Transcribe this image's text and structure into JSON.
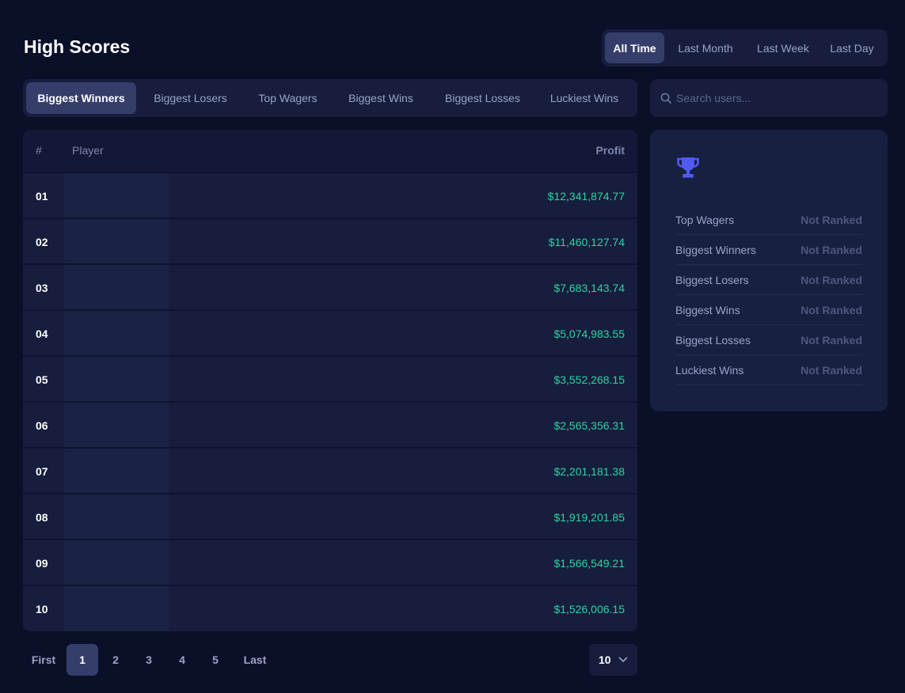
{
  "title": "High Scores",
  "period_tabs": [
    {
      "label": "All Time"
    },
    {
      "label": "Last Month"
    },
    {
      "label": "Last Week"
    },
    {
      "label": "Last Day"
    }
  ],
  "category_tabs": [
    {
      "label": "Biggest Winners"
    },
    {
      "label": "Biggest Losers"
    },
    {
      "label": "Top Wagers"
    },
    {
      "label": "Biggest Wins"
    },
    {
      "label": "Biggest Losses"
    },
    {
      "label": "Luckiest Wins"
    }
  ],
  "search": {
    "placeholder": "Search users...",
    "icon": "search-icon"
  },
  "table": {
    "headers": {
      "rank": "#",
      "player": "Player",
      "profit": "Profit"
    },
    "rows": [
      {
        "rank": "01",
        "profit": "$12,341,874.77"
      },
      {
        "rank": "02",
        "profit": "$11,460,127.74"
      },
      {
        "rank": "03",
        "profit": "$7,683,143.74"
      },
      {
        "rank": "04",
        "profit": "$5,074,983.55"
      },
      {
        "rank": "05",
        "profit": "$3,552,268.15"
      },
      {
        "rank": "06",
        "profit": "$2,565,356.31"
      },
      {
        "rank": "07",
        "profit": "$2,201,181.38"
      },
      {
        "rank": "08",
        "profit": "$1,919,201.85"
      },
      {
        "rank": "09",
        "profit": "$1,566,549.21"
      },
      {
        "rank": "10",
        "profit": "$1,526,006.15"
      }
    ]
  },
  "pagination": {
    "first": "First",
    "pages": [
      "1",
      "2",
      "3",
      "4",
      "5"
    ],
    "last": "Last",
    "per_page": "10"
  },
  "rank_card": {
    "icon": "trophy-icon",
    "items": [
      {
        "label": "Top Wagers",
        "value": "Not Ranked"
      },
      {
        "label": "Biggest Winners",
        "value": "Not Ranked"
      },
      {
        "label": "Biggest Losers",
        "value": "Not Ranked"
      },
      {
        "label": "Biggest Wins",
        "value": "Not Ranked"
      },
      {
        "label": "Biggest Losses",
        "value": "Not Ranked"
      },
      {
        "label": "Luckiest Wins",
        "value": "Not Ranked"
      }
    ]
  },
  "colors": {
    "background": "#0b1029",
    "panel": "#161d3d",
    "active_tab": "#353e6b",
    "profit_green": "#2dd4a0",
    "trophy_blue": "#4f5bf0"
  }
}
